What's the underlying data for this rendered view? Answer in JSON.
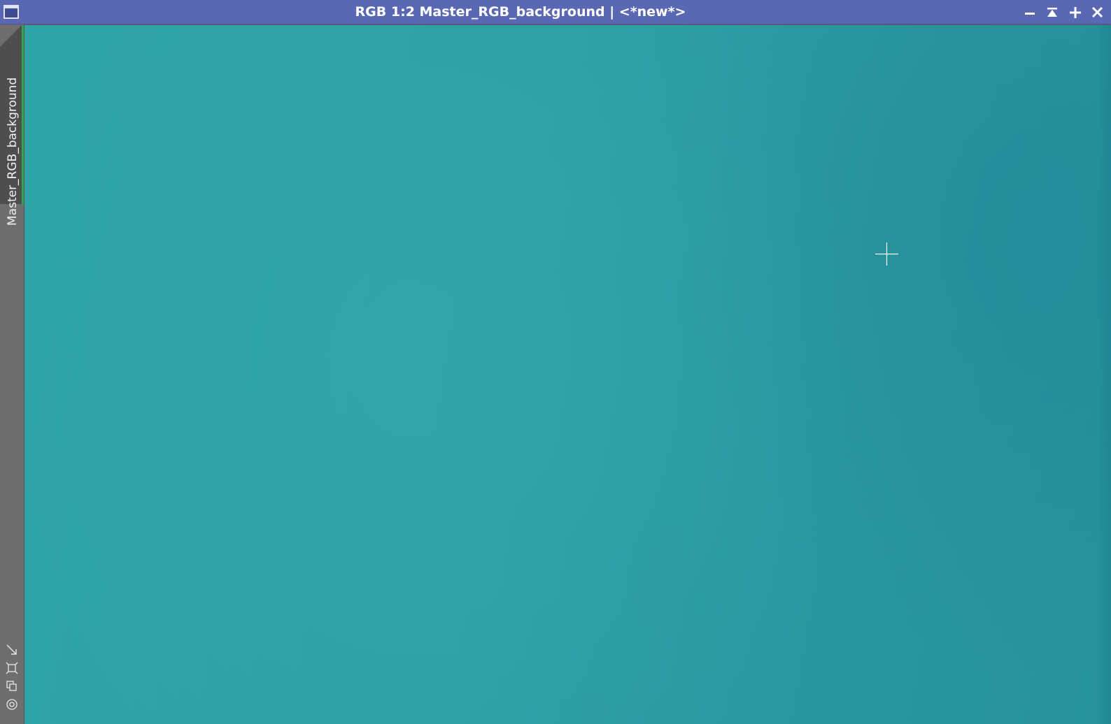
{
  "window": {
    "title": "RGB 1:2 Master_RGB_background | <*new*>",
    "icon": "window-icon",
    "buttons": {
      "minimize": "minimize-icon",
      "shade": "shade-icon",
      "maximize": "maximize-icon",
      "close": "close-icon"
    }
  },
  "sidebar": {
    "view_tab_label": "Master_RGB_background",
    "tab_accent_color": "#2ea84d",
    "tools": [
      "fit-view-icon",
      "zoom-to-fit-icon",
      "clone-view-icon",
      "target-icon"
    ]
  },
  "canvas": {
    "cursor": "crosshair-cursor",
    "dominant_color": "#2ea0a6"
  },
  "colors": {
    "titlebar": "#5a68b3",
    "strip": "#6e6e6e"
  }
}
